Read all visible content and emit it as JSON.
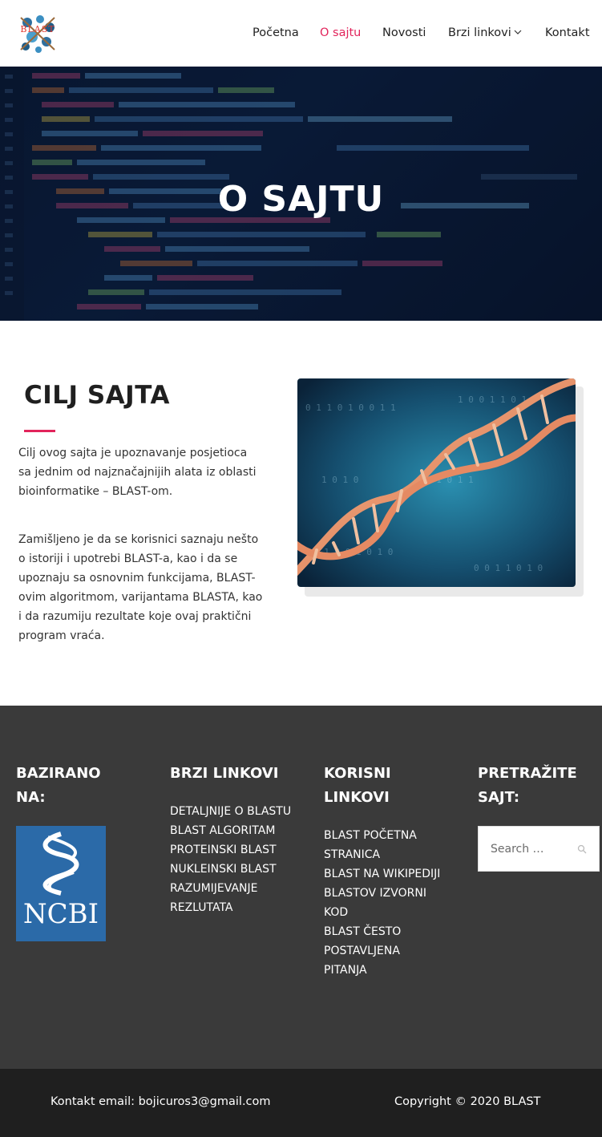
{
  "header": {
    "logo_text": "BLAST",
    "nav": [
      "Početna",
      "O sajtu",
      "Novosti",
      "Brzi linkovi",
      "Kontakt"
    ],
    "active_index": 1
  },
  "hero": {
    "title": "O SAJTU"
  },
  "about": {
    "title": "CILJ SAJTA",
    "paragraph1": "Cilj ovog sajta je upoznavanje posjetioca sa jednim od najznačajnijih alata iz oblasti bioinformatike – BLAST-om.",
    "paragraph2": "Zamišljeno je da se korisnici  saznaju nešto o istoriji i upotrebi BLAST-a, kao i da se upoznaju sa osnovnim funkcijama, BLAST-ovim algoritmom, varijantama BLASTA, kao i da razumiju rezultate koje ovaj praktični program vraća."
  },
  "footer": {
    "col1": {
      "title_line1": "BAZIRANO",
      "title_line2": "NA:",
      "logo_text": "NCBI"
    },
    "col2": {
      "title": "BRZI LINKOVI",
      "links": [
        "DETALJNIJE O BLASTU",
        "BLAST ALGORITAM",
        "PROTEINSKI BLAST",
        "NUKLEINSKI BLAST",
        "RAZUMIJEVANJE",
        "REZLUTATA"
      ]
    },
    "col3": {
      "title_line1": "KORISNI",
      "title_line2": "LINKOVI",
      "links": [
        "BLAST POČETNA",
        "STRANICA",
        "BLAST NA WIKIPEDIJI",
        "BLASTOV IZVORNI",
        "KOD",
        "BLAST ČESTO",
        "POSTAVLJENA",
        "PITANJA"
      ]
    },
    "col4": {
      "title_line1": "PRETRAŽITE",
      "title_line2": "SAJT:",
      "search_placeholder": "Search …"
    }
  },
  "bottom": {
    "contact": "Kontakt email: bojicuros3@gmail.com",
    "copyright": "Copyright © 2020 BLAST"
  },
  "colors": {
    "accent": "#e2245b",
    "footer_bg": "#3a3a3a",
    "bottom_bg": "#1f1f1f",
    "hero_bg": "#0c1f3d",
    "ncbi_blue": "#2b6aa8"
  }
}
